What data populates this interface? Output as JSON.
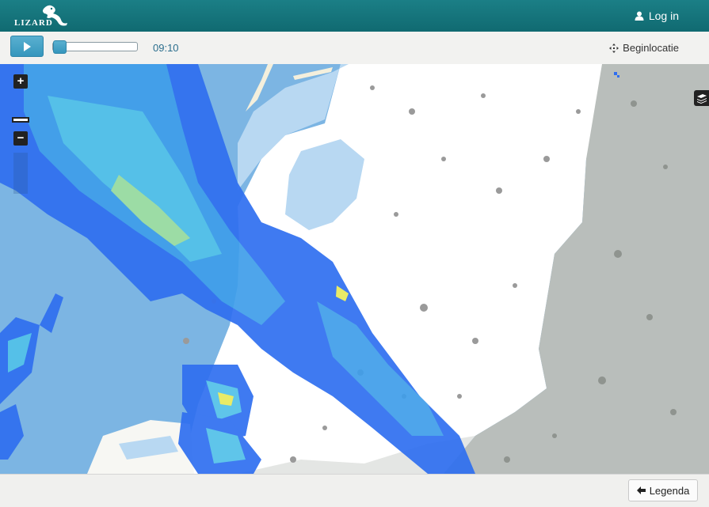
{
  "header": {
    "logo_text": "LIZARD",
    "login_label": "Log in",
    "login_icon": "user-icon"
  },
  "controls": {
    "play_icon": "play-icon",
    "timeline_progress": 0.0,
    "time": "09:10",
    "beginlocatie_label": "Beginlocatie",
    "beginlocatie_icon": "move-arrows-icon"
  },
  "map": {
    "zoom_in": "+",
    "zoom_out": "−",
    "layers_icon": "layers-icon",
    "colors": {
      "sea": "#7cb5e3",
      "land_nl": "#ffffff",
      "land_de": "#b7bcb9",
      "rain_light": "#2f6ff0",
      "rain_mid": "#49b7ea",
      "rain_heavy": "#e8ea5b"
    }
  },
  "footer": {
    "legenda_label": "Legenda",
    "legenda_icon": "arrow-left-icon"
  },
  "colors": {
    "brand": "#137378",
    "accent": "#3a9bc2"
  }
}
